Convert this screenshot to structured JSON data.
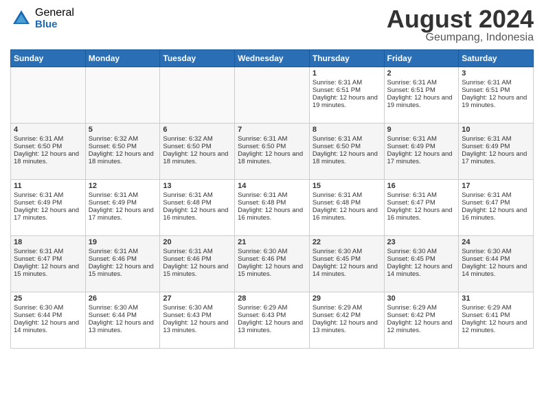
{
  "logo": {
    "general": "General",
    "blue": "Blue"
  },
  "title": "August 2024",
  "location": "Geumpang, Indonesia",
  "days_header": [
    "Sunday",
    "Monday",
    "Tuesday",
    "Wednesday",
    "Thursday",
    "Friday",
    "Saturday"
  ],
  "weeks": [
    [
      {
        "day": "",
        "sunrise": "",
        "sunset": "",
        "daylight": ""
      },
      {
        "day": "",
        "sunrise": "",
        "sunset": "",
        "daylight": ""
      },
      {
        "day": "",
        "sunrise": "",
        "sunset": "",
        "daylight": ""
      },
      {
        "day": "",
        "sunrise": "",
        "sunset": "",
        "daylight": ""
      },
      {
        "day": "1",
        "sunrise": "Sunrise: 6:31 AM",
        "sunset": "Sunset: 6:51 PM",
        "daylight": "Daylight: 12 hours and 19 minutes."
      },
      {
        "day": "2",
        "sunrise": "Sunrise: 6:31 AM",
        "sunset": "Sunset: 6:51 PM",
        "daylight": "Daylight: 12 hours and 19 minutes."
      },
      {
        "day": "3",
        "sunrise": "Sunrise: 6:31 AM",
        "sunset": "Sunset: 6:51 PM",
        "daylight": "Daylight: 12 hours and 19 minutes."
      }
    ],
    [
      {
        "day": "4",
        "sunrise": "Sunrise: 6:31 AM",
        "sunset": "Sunset: 6:50 PM",
        "daylight": "Daylight: 12 hours and 18 minutes."
      },
      {
        "day": "5",
        "sunrise": "Sunrise: 6:32 AM",
        "sunset": "Sunset: 6:50 PM",
        "daylight": "Daylight: 12 hours and 18 minutes."
      },
      {
        "day": "6",
        "sunrise": "Sunrise: 6:32 AM",
        "sunset": "Sunset: 6:50 PM",
        "daylight": "Daylight: 12 hours and 18 minutes."
      },
      {
        "day": "7",
        "sunrise": "Sunrise: 6:31 AM",
        "sunset": "Sunset: 6:50 PM",
        "daylight": "Daylight: 12 hours and 18 minutes."
      },
      {
        "day": "8",
        "sunrise": "Sunrise: 6:31 AM",
        "sunset": "Sunset: 6:50 PM",
        "daylight": "Daylight: 12 hours and 18 minutes."
      },
      {
        "day": "9",
        "sunrise": "Sunrise: 6:31 AM",
        "sunset": "Sunset: 6:49 PM",
        "daylight": "Daylight: 12 hours and 17 minutes."
      },
      {
        "day": "10",
        "sunrise": "Sunrise: 6:31 AM",
        "sunset": "Sunset: 6:49 PM",
        "daylight": "Daylight: 12 hours and 17 minutes."
      }
    ],
    [
      {
        "day": "11",
        "sunrise": "Sunrise: 6:31 AM",
        "sunset": "Sunset: 6:49 PM",
        "daylight": "Daylight: 12 hours and 17 minutes."
      },
      {
        "day": "12",
        "sunrise": "Sunrise: 6:31 AM",
        "sunset": "Sunset: 6:49 PM",
        "daylight": "Daylight: 12 hours and 17 minutes."
      },
      {
        "day": "13",
        "sunrise": "Sunrise: 6:31 AM",
        "sunset": "Sunset: 6:48 PM",
        "daylight": "Daylight: 12 hours and 16 minutes."
      },
      {
        "day": "14",
        "sunrise": "Sunrise: 6:31 AM",
        "sunset": "Sunset: 6:48 PM",
        "daylight": "Daylight: 12 hours and 16 minutes."
      },
      {
        "day": "15",
        "sunrise": "Sunrise: 6:31 AM",
        "sunset": "Sunset: 6:48 PM",
        "daylight": "Daylight: 12 hours and 16 minutes."
      },
      {
        "day": "16",
        "sunrise": "Sunrise: 6:31 AM",
        "sunset": "Sunset: 6:47 PM",
        "daylight": "Daylight: 12 hours and 16 minutes."
      },
      {
        "day": "17",
        "sunrise": "Sunrise: 6:31 AM",
        "sunset": "Sunset: 6:47 PM",
        "daylight": "Daylight: 12 hours and 16 minutes."
      }
    ],
    [
      {
        "day": "18",
        "sunrise": "Sunrise: 6:31 AM",
        "sunset": "Sunset: 6:47 PM",
        "daylight": "Daylight: 12 hours and 15 minutes."
      },
      {
        "day": "19",
        "sunrise": "Sunrise: 6:31 AM",
        "sunset": "Sunset: 6:46 PM",
        "daylight": "Daylight: 12 hours and 15 minutes."
      },
      {
        "day": "20",
        "sunrise": "Sunrise: 6:31 AM",
        "sunset": "Sunset: 6:46 PM",
        "daylight": "Daylight: 12 hours and 15 minutes."
      },
      {
        "day": "21",
        "sunrise": "Sunrise: 6:30 AM",
        "sunset": "Sunset: 6:46 PM",
        "daylight": "Daylight: 12 hours and 15 minutes."
      },
      {
        "day": "22",
        "sunrise": "Sunrise: 6:30 AM",
        "sunset": "Sunset: 6:45 PM",
        "daylight": "Daylight: 12 hours and 14 minutes."
      },
      {
        "day": "23",
        "sunrise": "Sunrise: 6:30 AM",
        "sunset": "Sunset: 6:45 PM",
        "daylight": "Daylight: 12 hours and 14 minutes."
      },
      {
        "day": "24",
        "sunrise": "Sunrise: 6:30 AM",
        "sunset": "Sunset: 6:44 PM",
        "daylight": "Daylight: 12 hours and 14 minutes."
      }
    ],
    [
      {
        "day": "25",
        "sunrise": "Sunrise: 6:30 AM",
        "sunset": "Sunset: 6:44 PM",
        "daylight": "Daylight: 12 hours and 14 minutes."
      },
      {
        "day": "26",
        "sunrise": "Sunrise: 6:30 AM",
        "sunset": "Sunset: 6:44 PM",
        "daylight": "Daylight: 12 hours and 13 minutes."
      },
      {
        "day": "27",
        "sunrise": "Sunrise: 6:30 AM",
        "sunset": "Sunset: 6:43 PM",
        "daylight": "Daylight: 12 hours and 13 minutes."
      },
      {
        "day": "28",
        "sunrise": "Sunrise: 6:29 AM",
        "sunset": "Sunset: 6:43 PM",
        "daylight": "Daylight: 12 hours and 13 minutes."
      },
      {
        "day": "29",
        "sunrise": "Sunrise: 6:29 AM",
        "sunset": "Sunset: 6:42 PM",
        "daylight": "Daylight: 12 hours and 13 minutes."
      },
      {
        "day": "30",
        "sunrise": "Sunrise: 6:29 AM",
        "sunset": "Sunset: 6:42 PM",
        "daylight": "Daylight: 12 hours and 12 minutes."
      },
      {
        "day": "31",
        "sunrise": "Sunrise: 6:29 AM",
        "sunset": "Sunset: 6:41 PM",
        "daylight": "Daylight: 12 hours and 12 minutes."
      }
    ]
  ]
}
